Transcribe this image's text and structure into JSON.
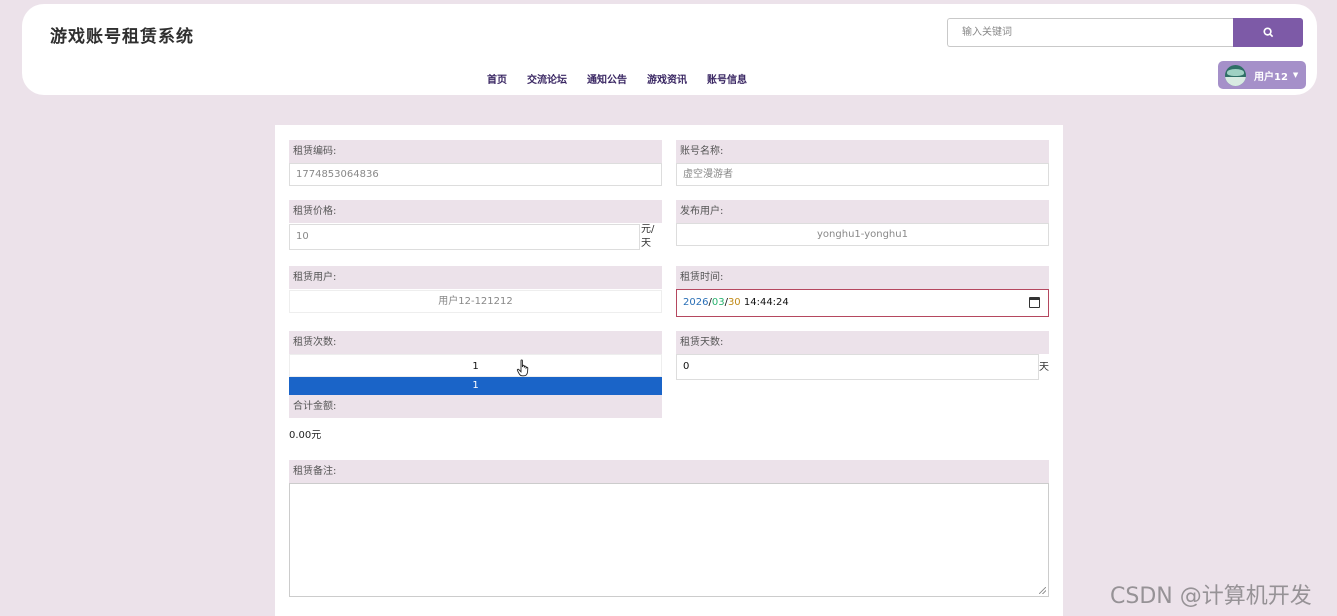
{
  "header": {
    "site_title": "游戏账号租赁系统",
    "search_placeholder": "输入关键词",
    "search_icon": "search-icon",
    "nav": [
      "首页",
      "交流论坛",
      "通知公告",
      "游戏资讯",
      "账号信息"
    ],
    "user_name": "用户12"
  },
  "form": {
    "rental_code_label": "租赁编码:",
    "rental_code_value": "1774853064836",
    "account_name_label": "账号名称:",
    "account_name_value": "虚空漫游者",
    "price_label": "租赁价格:",
    "price_value": "10",
    "price_unit": "元/天",
    "publisher_label": "发布用户:",
    "publisher_value": "yonghu1-yonghu1",
    "renter_label": "租赁用户:",
    "renter_value": "用户12-121212",
    "rental_time_label": "租赁时间:",
    "rental_time_year": "2026",
    "rental_time_month": "03",
    "rental_time_day": "30",
    "rental_time_clock": "14:44:24",
    "rental_count_label": "租赁次数:",
    "rental_count_value": "1",
    "rental_count_option": "1",
    "rental_days_label": "租赁天数:",
    "rental_days_value": "0",
    "rental_days_unit": "天",
    "total_label": "合计金额:",
    "total_value": "0.00元",
    "remark_label": "租赁备注:"
  },
  "watermark": "CSDN @计算机开发"
}
